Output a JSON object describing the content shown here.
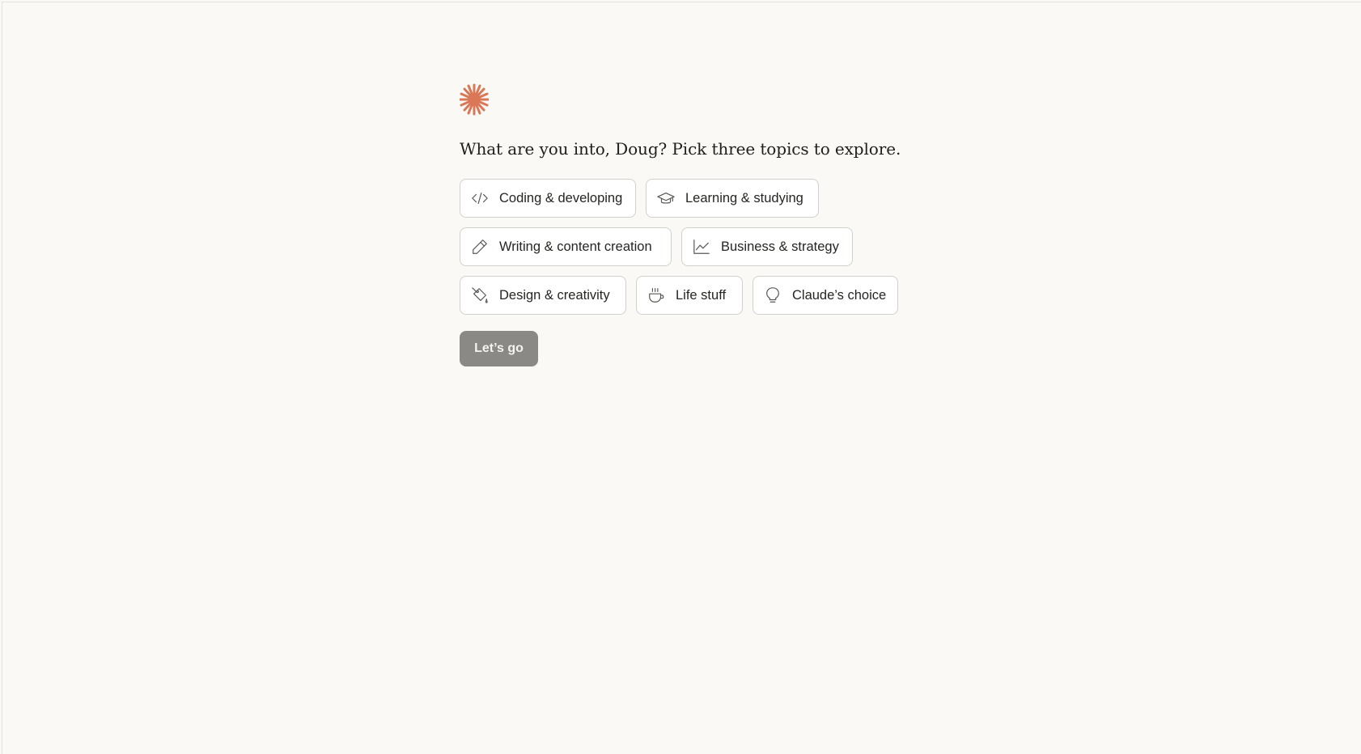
{
  "brand": {
    "logo_icon": "claude-starburst-icon",
    "accent_color": "#d97757"
  },
  "headline": "What are you into, Doug? Pick three topics to explore.",
  "topics": [
    {
      "label": "Coding & developing",
      "icon": "code-icon"
    },
    {
      "label": "Learning & studying",
      "icon": "graduation-cap-icon"
    },
    {
      "label": "Writing & content creation",
      "icon": "pencil-icon"
    },
    {
      "label": "Business & strategy",
      "icon": "line-chart-icon"
    },
    {
      "label": "Design & creativity",
      "icon": "paint-bucket-icon"
    },
    {
      "label": "Life stuff",
      "icon": "coffee-cup-icon"
    },
    {
      "label": "Claude’s choice",
      "icon": "lightbulb-icon"
    }
  ],
  "submit": {
    "label": "Let’s go",
    "disabled_color": "#8a8986"
  }
}
